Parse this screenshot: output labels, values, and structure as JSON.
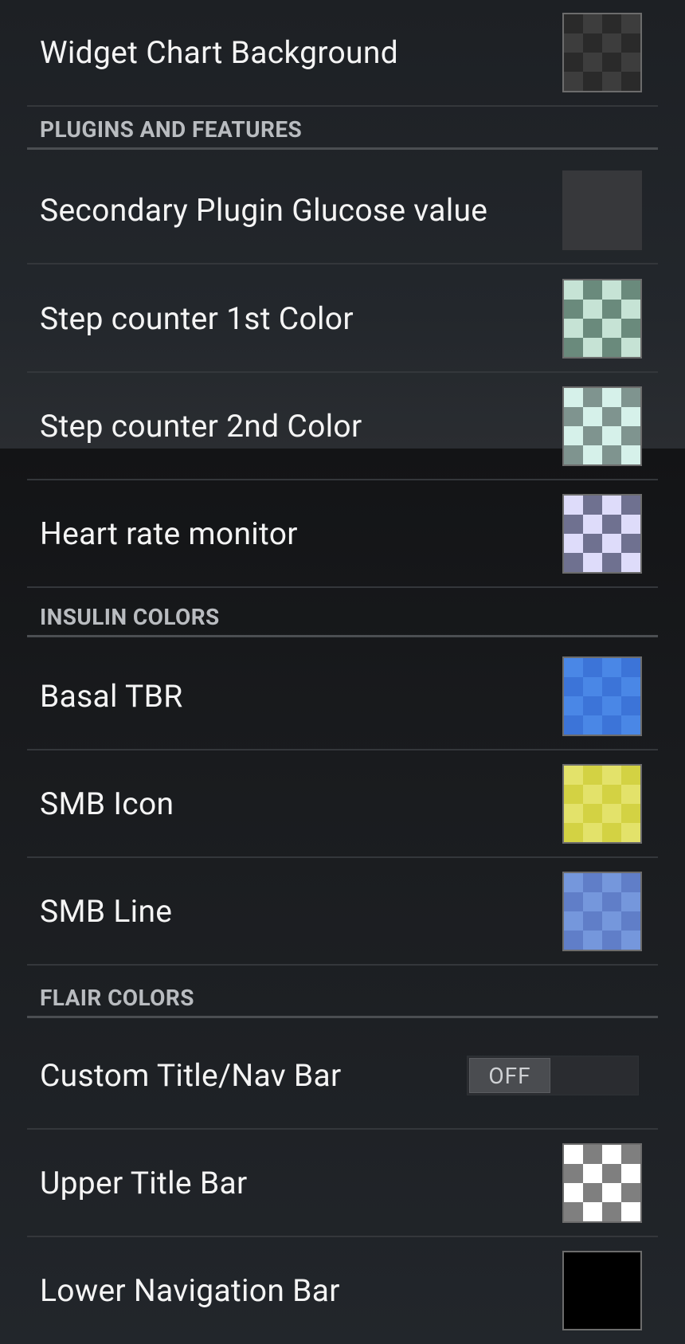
{
  "rows": {
    "widget_chart_background": {
      "label": "Widget Chart Background",
      "swatch": "checker-dark"
    },
    "secondary_plugin_glucose": {
      "label": "Secondary Plugin Glucose value",
      "swatch": "solid-dark"
    },
    "step_counter_1st": {
      "label": "Step counter 1st Color",
      "swatch": "checker-green"
    },
    "step_counter_2nd": {
      "label": "Step counter 2nd Color",
      "swatch": "checker-teal"
    },
    "heart_rate_monitor": {
      "label": "Heart rate monitor",
      "swatch": "checker-lavender"
    },
    "basal_tbr": {
      "label": "Basal TBR",
      "swatch": "checker-blue"
    },
    "smb_icon": {
      "label": "SMB Icon",
      "swatch": "checker-yellow"
    },
    "smb_line": {
      "label": "SMB Line",
      "swatch": "checker-periwinkle"
    },
    "custom_title_nav_bar": {
      "label": "Custom Title/Nav Bar",
      "toggle_text": "OFF"
    },
    "upper_title_bar": {
      "label": "Upper Title Bar",
      "swatch": "checker-white"
    },
    "lower_navigation_bar": {
      "label": "Lower Navigation Bar",
      "swatch": "solid-black"
    }
  },
  "sections": {
    "plugins": "PLUGINS AND FEATURES",
    "insulin": "INSULIN COLORS",
    "flair": "FLAIR COLORS"
  },
  "colors": {
    "checker_dark": [
      "#3d3d3d",
      "#2a2a2a"
    ],
    "solid_dark": "#37383b",
    "checker_green": [
      "#6a8a7c",
      "#c6e3d5"
    ],
    "checker_teal": [
      "#7f948f",
      "#d6f1ea"
    ],
    "checker_lavender": [
      "#6f7190",
      "#dedcfa"
    ],
    "checker_blue": [
      "#3c74d8",
      "#4a87e6"
    ],
    "checker_yellow": [
      "#d3d243",
      "#e3e26a"
    ],
    "checker_periwinkle": [
      "#607ec8",
      "#7597dc"
    ],
    "checker_white": [
      "#7f7f7f",
      "#ffffff"
    ],
    "solid_black": "#000000"
  }
}
